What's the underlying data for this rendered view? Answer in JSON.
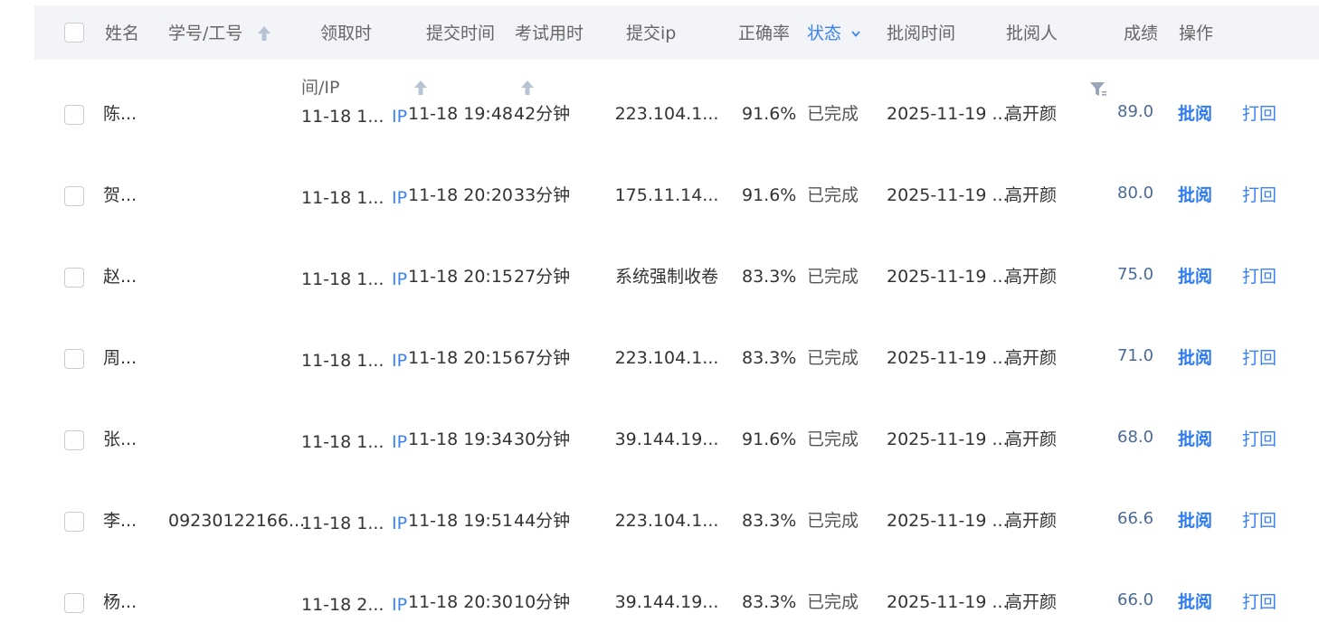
{
  "header": {
    "name": "姓名",
    "student_id": "学号/工号",
    "claim_time": "领取时",
    "claim_time_cont": "间/IP",
    "submit_time": "提交时间",
    "exam_duration": "考试用时",
    "submit_ip": "提交ip",
    "accuracy": "正确率",
    "status": "状态",
    "review_time": "批阅时间",
    "reviewer": "批阅人",
    "score": "成绩",
    "actions": "操作"
  },
  "colors": {
    "accent": "#3b82f6",
    "header_bg": "#f2f4f8",
    "score_text": "#4a6a95"
  },
  "rows": [
    {
      "name": "陈...",
      "student_id": "",
      "claim_time": "11-18 1...",
      "ip_link": "IP",
      "submit_time": "11-18 19:48",
      "duration": "42分钟",
      "submit_ip": "223.104.1...",
      "accuracy": "91.6%",
      "status": "已完成",
      "review_time": "2025-11-19 ...",
      "reviewer": "高开颜",
      "score": "89.0",
      "review_action": "批阅",
      "reject_action": "打回"
    },
    {
      "name": "贺...",
      "student_id": "",
      "claim_time": "11-18 1...",
      "ip_link": "IP",
      "submit_time": "11-18 20:20",
      "duration": "33分钟",
      "submit_ip": "175.11.14...",
      "accuracy": "91.6%",
      "status": "已完成",
      "review_time": "2025-11-19 ...",
      "reviewer": "高开颜",
      "score": "80.0",
      "review_action": "批阅",
      "reject_action": "打回"
    },
    {
      "name": "赵...",
      "student_id": "",
      "claim_time": "11-18 1...",
      "ip_link": "IP",
      "submit_time": "11-18 20:15",
      "duration": "27分钟",
      "submit_ip": "系统强制收卷",
      "accuracy": "83.3%",
      "status": "已完成",
      "review_time": "2025-11-19 ...",
      "reviewer": "高开颜",
      "score": "75.0",
      "review_action": "批阅",
      "reject_action": "打回"
    },
    {
      "name": "周...",
      "student_id": "",
      "claim_time": "11-18 1...",
      "ip_link": "IP",
      "submit_time": "11-18 20:15",
      "duration": "67分钟",
      "submit_ip": "223.104.1...",
      "accuracy": "83.3%",
      "status": "已完成",
      "review_time": "2025-11-19 ...",
      "reviewer": "高开颜",
      "score": "71.0",
      "review_action": "批阅",
      "reject_action": "打回"
    },
    {
      "name": "张...",
      "student_id": "",
      "claim_time": "11-18 1...",
      "ip_link": "IP",
      "submit_time": "11-18 19:34",
      "duration": "30分钟",
      "submit_ip": "39.144.19...",
      "accuracy": "91.6%",
      "status": "已完成",
      "review_time": "2025-11-19 ...",
      "reviewer": "高开颜",
      "score": "68.0",
      "review_action": "批阅",
      "reject_action": "打回"
    },
    {
      "name": "李...",
      "student_id": "09230122166...",
      "claim_time": "11-18 1...",
      "ip_link": "IP",
      "submit_time": "11-18 19:51",
      "duration": "44分钟",
      "submit_ip": "223.104.1...",
      "accuracy": "83.3%",
      "status": "已完成",
      "review_time": "2025-11-19 ...",
      "reviewer": "高开颜",
      "score": "66.6",
      "review_action": "批阅",
      "reject_action": "打回"
    },
    {
      "name": "杨...",
      "student_id": "",
      "claim_time": "11-18 2...",
      "ip_link": "IP",
      "submit_time": "11-18 20:30",
      "duration": "10分钟",
      "submit_ip": "39.144.19...",
      "accuracy": "83.3%",
      "status": "已完成",
      "review_time": "2025-11-19 ...",
      "reviewer": "高开颜",
      "score": "66.0",
      "review_action": "批阅",
      "reject_action": "打回"
    }
  ]
}
